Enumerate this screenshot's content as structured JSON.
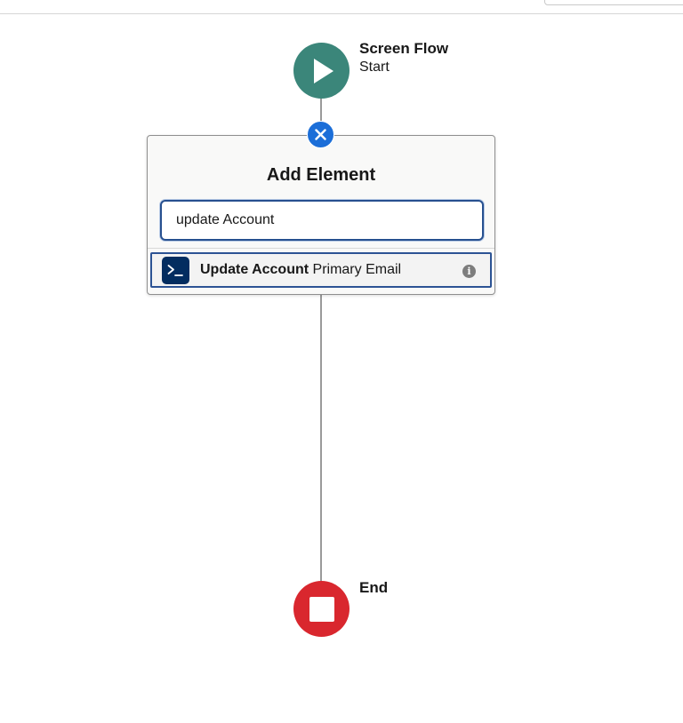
{
  "start_node": {
    "title": "Screen Flow",
    "subtitle": "Start",
    "icon": "play-icon",
    "color": "#3b867a"
  },
  "add_element_panel": {
    "title": "Add Element",
    "close_icon": "close-icon",
    "search": {
      "value": "update Account",
      "placeholder": ""
    },
    "results": [
      {
        "icon": "terminal-action-icon",
        "match_text": "Update Account",
        "rest_text": " Primary Email",
        "info_icon": "info-icon"
      }
    ]
  },
  "end_node": {
    "title": "End",
    "icon": "stop-icon",
    "color": "#d9272e"
  },
  "colors": {
    "accent_blue": "#1b6ed8",
    "focus_border": "#27508f",
    "action_icon_bg": "#032d60"
  }
}
